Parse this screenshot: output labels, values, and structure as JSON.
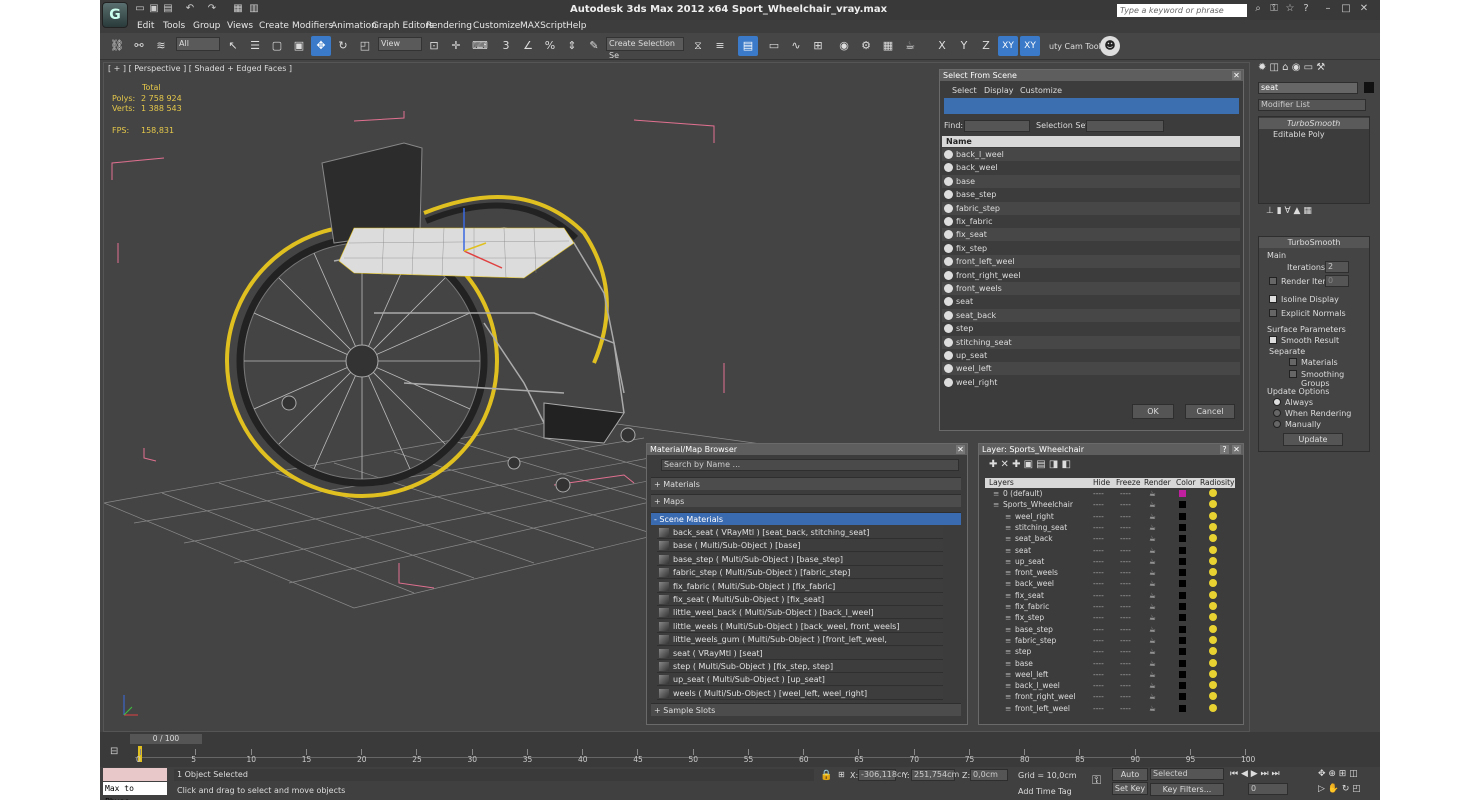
{
  "app": {
    "title": "Autodesk 3ds Max  2012 x64     Sport_Wheelchair_vray.max",
    "search_placeholder": "Type a keyword or phrase"
  },
  "menu": [
    "Edit",
    "Tools",
    "Group",
    "Views",
    "Create",
    "Modifiers",
    "Animation",
    "Graph Editors",
    "Rendering",
    "Customize",
    "MAXScript",
    "Help"
  ],
  "toolbar": {
    "filter": "All",
    "view": "View",
    "selection_set": "Create Selection Se",
    "axes": [
      "X",
      "Y",
      "Z",
      "XY",
      "XY"
    ],
    "cam_tool": "uty Cam Tool ▾"
  },
  "viewport": {
    "label": "[ + ] [ Perspective ] [ Shaded + Edged Faces ]",
    "stats": {
      "total_label": "Total",
      "polys_label": "Polys:",
      "polys": "2 758 924",
      "verts_label": "Verts:",
      "verts": "1 388 543",
      "fps_label": "FPS:",
      "fps": "158,831"
    }
  },
  "select_from_scene": {
    "title": "Select From Scene",
    "menu": [
      "Select",
      "Display",
      "Customize"
    ],
    "find_label": "Find:",
    "selset_label": "Selection Set:",
    "column": "Name",
    "items": [
      "back_l_weel",
      "back_weel",
      "base",
      "base_step",
      "fabric_step",
      "fix_fabric",
      "fix_seat",
      "fix_step",
      "front_left_weel",
      "front_right_weel",
      "front_weels",
      "seat",
      "seat_back",
      "step",
      "stitching_seat",
      "up_seat",
      "weel_left",
      "weel_right"
    ],
    "ok": "OK",
    "cancel": "Cancel"
  },
  "material_browser": {
    "title": "Material/Map Browser",
    "search_placeholder": "Search by Name ...",
    "sections": [
      "+ Materials",
      "+ Maps",
      "- Scene Materials",
      "+ Sample Slots"
    ],
    "materials": [
      "back_seat  ( VRayMtl ) [seat_back, stitching_seat]",
      "base  ( Multi/Sub-Object ) [base]",
      "base_step  ( Multi/Sub-Object ) [base_step]",
      "fabric_step  ( Multi/Sub-Object ) [fabric_step]",
      "fix_fabric  ( Multi/Sub-Object ) [fix_fabric]",
      "fix_seat  ( Multi/Sub-Object ) [fix_seat]",
      "little_weel_back  ( Multi/Sub-Object ) [back_l_weel]",
      "little_weels  ( Multi/Sub-Object ) [back_weel, front_weels]",
      "little_weels_gum  ( Multi/Sub-Object ) [front_left_weel, front_right_weel]",
      "seat  ( VRayMtl ) [seat]",
      "step  ( Multi/Sub-Object ) [fix_step, step]",
      "up_seat  ( Multi/Sub-Object ) [up_seat]",
      "weels  ( Multi/Sub-Object ) [weel_left, weel_right]"
    ]
  },
  "layer_panel": {
    "title": "Layer: Sports_Wheelchair",
    "columns": [
      "Layers",
      "Hide",
      "Freeze",
      "Render",
      "Color",
      "Radiosity"
    ],
    "layers": [
      {
        "name": "0 (default)",
        "indent": 0
      },
      {
        "name": "Sports_Wheelchair",
        "indent": 0
      },
      {
        "name": "weel_right",
        "indent": 1
      },
      {
        "name": "stitching_seat",
        "indent": 1
      },
      {
        "name": "seat_back",
        "indent": 1
      },
      {
        "name": "seat",
        "indent": 1
      },
      {
        "name": "up_seat",
        "indent": 1
      },
      {
        "name": "front_weels",
        "indent": 1
      },
      {
        "name": "back_weel",
        "indent": 1
      },
      {
        "name": "fix_seat",
        "indent": 1
      },
      {
        "name": "fix_fabric",
        "indent": 1
      },
      {
        "name": "fix_step",
        "indent": 1
      },
      {
        "name": "base_step",
        "indent": 1
      },
      {
        "name": "fabric_step",
        "indent": 1
      },
      {
        "name": "step",
        "indent": 1
      },
      {
        "name": "base",
        "indent": 1
      },
      {
        "name": "weel_left",
        "indent": 1
      },
      {
        "name": "back_l_weel",
        "indent": 1
      },
      {
        "name": "front_right_weel",
        "indent": 1
      },
      {
        "name": "front_left_weel",
        "indent": 1
      }
    ],
    "dash": "----"
  },
  "command_panel": {
    "object_name": "seat",
    "modifier_list": "Modifier List",
    "stack": [
      "TurboSmooth",
      "Editable Poly"
    ],
    "rollout_title": "TurboSmooth",
    "main_label": "Main",
    "iterations_label": "Iterations:",
    "iterations": "2",
    "render_iters_label": "Render Iters:",
    "render_iters": "0",
    "isoline": "Isoline Display",
    "explicit": "Explicit Normals",
    "surface_params": "Surface Parameters",
    "smooth_result": "Smooth Result",
    "separate": "Separate",
    "materials": "Materials",
    "smoothing_groups": "Smoothing Groups",
    "update_options": "Update Options",
    "always": "Always",
    "when_rendering": "When Rendering",
    "manually": "Manually",
    "update": "Update"
  },
  "timeline": {
    "frame": "0 / 100",
    "ticks": [
      "0",
      "5",
      "10",
      "15",
      "20",
      "25",
      "30",
      "35",
      "40",
      "45",
      "50",
      "55",
      "60",
      "65",
      "70",
      "75",
      "80",
      "85",
      "90",
      "95",
      "100"
    ]
  },
  "status": {
    "script_label": "Max to Physc.",
    "selected": "1 Object Selected",
    "prompt": "Click and drag to select and move objects",
    "x_label": "X:",
    "x": "-306,118cr",
    "y_label": "Y:",
    "y": "251,754cm",
    "z_label": "Z:",
    "z": "0,0cm",
    "grid": "Grid = 10,0cm",
    "add_time_tag": "Add Time Tag",
    "auto_key": "Auto Key",
    "set_key": "Set Key",
    "key_mode": "Selected",
    "key_filters": "Key Filters...",
    "frame_field": "0"
  },
  "colors": {
    "accent": "#3a7ac8",
    "wheel_trim": "#e0c020",
    "grid": "#8a8a8a",
    "bbox": "#e07090",
    "radiosity": "#e8d232"
  }
}
